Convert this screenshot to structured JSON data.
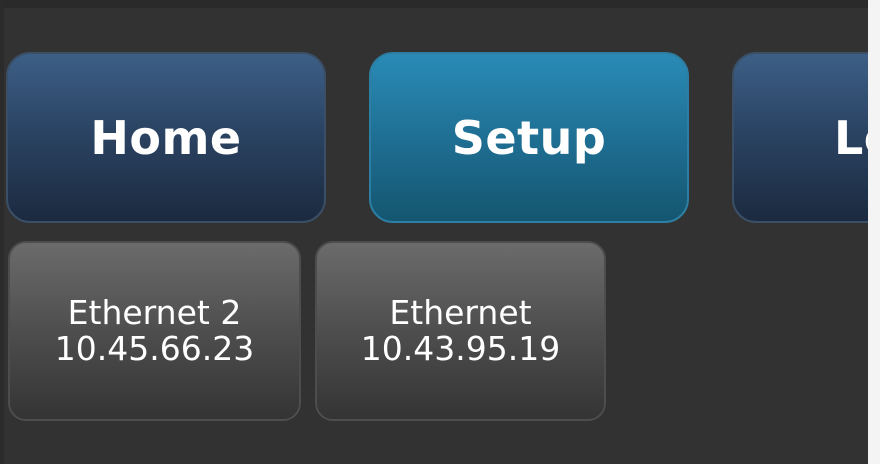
{
  "nav": {
    "home_label": "Home",
    "setup_label": "Setup",
    "third_label": "Lo"
  },
  "networks": [
    {
      "name": "Ethernet 2",
      "ip": "10.45.66.23"
    },
    {
      "name": "Ethernet",
      "ip": "10.43.95.19"
    }
  ],
  "colors": {
    "background": "#323232",
    "nav_button": "#2b4464",
    "active_button": "#1f6f94",
    "network_button": "#4e4e4e",
    "text": "#ffffff"
  }
}
